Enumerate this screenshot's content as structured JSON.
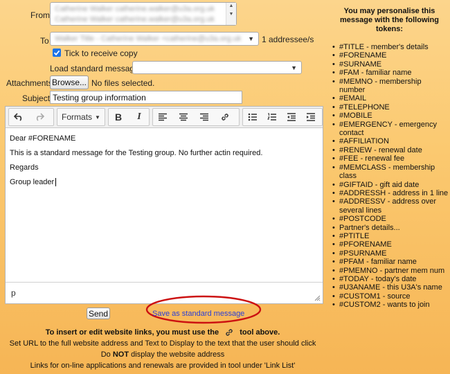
{
  "form": {
    "from_label": "From",
    "from_options": [
      "Catherine Walker catherine.walker@u3a.org.uk",
      "Catherine Walker catherine.walker@u3a.org.uk"
    ],
    "to_label": "To",
    "to_value": "Walker Title - Catherine Walker <catherine@u3a.org.uk>",
    "addressee_count": "1 addressee/s",
    "copy_label": "Tick to receive copy",
    "copy_checked": true,
    "load_label": "Load standard message",
    "load_value": "",
    "attachments_label": "Attachments",
    "browse_label": "Browse...",
    "no_files": "No files selected.",
    "subject_label": "Subject",
    "subject_value": "Testing group information"
  },
  "toolbar": {
    "formats_label": "Formats",
    "bold": "B",
    "italic": "I"
  },
  "editor": {
    "lines": [
      "Dear #FORENAME",
      "This is a standard message for the Testing group.  No further actin required.",
      "Regards",
      "Group leader"
    ],
    "statusbar_path": "p"
  },
  "actions": {
    "send_label": "Send",
    "save_standard_label": "Save as standard message"
  },
  "info": {
    "line1_prefix": "To insert or edit website links, you must use the",
    "line1_suffix": "tool above.",
    "line2": "Set URL to the full website address and Text to Display to the text that the user should click",
    "line3_prefix": "Do",
    "line3_strong": "NOT",
    "line3_suffix": "display the website address",
    "line4": "Links for on-line applications and renewals are provided in tool under 'Link List'"
  },
  "tokens": {
    "heading": "You may personalise this message with the following tokens:",
    "items": [
      "#TITLE - member's details",
      "#FORENAME",
      "#SURNAME",
      "#FAM - familiar name",
      "#MEMNO - membership number",
      "#EMAIL",
      "#TELEPHONE",
      "#MOBILE",
      "#EMERGENCY - emergency contact",
      "#AFFILIATION",
      "#RENEW - renewal date",
      "#FEE - renewal fee",
      "#MEMCLASS - membership class",
      "#GIFTAID - gift aid date",
      "#ADDRESSH - address in 1 line",
      "#ADDRESSV - address over several lines",
      "#POSTCODE",
      "Partner's details...",
      "#PTITLE",
      "#PFORENAME",
      "#PSURNAME",
      "#PFAM - familiar name",
      "#PMEMNO - partner mem num",
      "#TODAY - today's date",
      "#U3ANAME - this U3A's name",
      "#CUSTOM1 - source",
      "#CUSTOM2 - wants to join"
    ]
  },
  "colors": {
    "highlight_circle": "#cc1111",
    "link": "#2a3fd6",
    "checkbox": "#1a73e8"
  }
}
